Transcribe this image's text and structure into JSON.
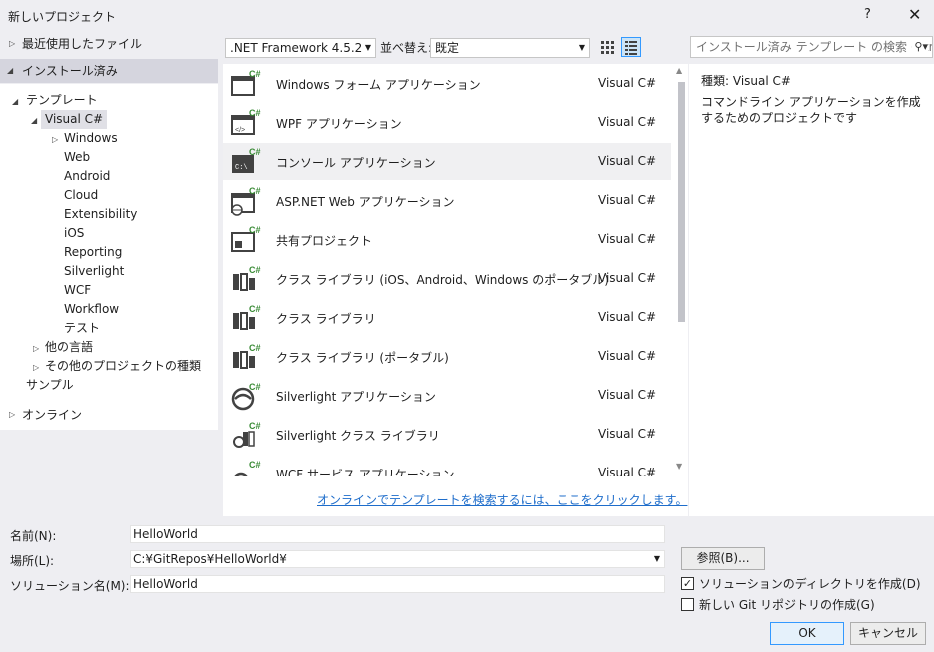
{
  "window": {
    "title": "新しいプロジェクト",
    "help_label": "?",
    "close_label": "✕"
  },
  "left": {
    "recent": "最近使用したファイル",
    "installed": "インストール済み",
    "templates": "テンプレート",
    "visual_csharp": "Visual C#",
    "children": [
      "Windows",
      "Web",
      "Android",
      "Cloud",
      "Extensibility",
      "iOS",
      "Reporting",
      "Silverlight",
      "WCF",
      "Workflow",
      "テスト"
    ],
    "other_languages": "他の言語",
    "other_project_types": "その他のプロジェクトの種類",
    "samples": "サンプル",
    "online": "オンライン"
  },
  "toolbar": {
    "framework": ".NET Framework 4.5.2",
    "sort_label": "並べ替え:",
    "sort_value": "既定",
    "search_placeholder": "インストール済み テンプレート の検索 (Ctrl+E"
  },
  "templates": [
    {
      "name": "Windows フォーム アプリケーション",
      "lang": "Visual C#",
      "icon": "windows-forms-icon"
    },
    {
      "name": "WPF アプリケーション",
      "lang": "Visual C#",
      "icon": "wpf-icon"
    },
    {
      "name": "コンソール アプリケーション",
      "lang": "Visual C#",
      "icon": "console-icon",
      "selected": true
    },
    {
      "name": "ASP.NET Web アプリケーション",
      "lang": "Visual C#",
      "icon": "web-icon"
    },
    {
      "name": "共有プロジェクト",
      "lang": "Visual C#",
      "icon": "shared-project-icon"
    },
    {
      "name": "クラス ライブラリ (iOS、Android、Windows のポータブル)",
      "lang": "Visual C#",
      "icon": "class-library-portable-icon"
    },
    {
      "name": "クラス ライブラリ",
      "lang": "Visual C#",
      "icon": "class-library-icon"
    },
    {
      "name": "クラス ライブラリ (ポータブル)",
      "lang": "Visual C#",
      "icon": "class-library-portable-icon"
    },
    {
      "name": "Silverlight アプリケーション",
      "lang": "Visual C#",
      "icon": "silverlight-icon"
    },
    {
      "name": "Silverlight クラス ライブラリ",
      "lang": "Visual C#",
      "icon": "silverlight-library-icon"
    },
    {
      "name": "WCF サービス アプリケーション",
      "lang": "Visual C#",
      "icon": "wcf-icon"
    }
  ],
  "online_link": "オンラインでテンプレートを検索するには、ここをクリックします。",
  "description": {
    "kind_label": "種類:",
    "kind_value": "Visual C#",
    "text": "コマンドライン アプリケーションを作成するためのプロジェクトです"
  },
  "form": {
    "name_label": "名前(N):",
    "name_value": "HelloWorld",
    "location_label": "場所(L):",
    "location_value": "C:¥GitRepos¥HelloWorld¥",
    "solution_label": "ソリューション名(M):",
    "solution_value": "HelloWorld",
    "browse_label": "参照(B)...",
    "create_dir_label": "ソリューションのディレクトリを作成(D)",
    "create_dir_checked": true,
    "git_label": "新しい Git リポジトリの作成(G)",
    "git_checked": false,
    "ok_label": "OK",
    "cancel_label": "キャンセル"
  }
}
